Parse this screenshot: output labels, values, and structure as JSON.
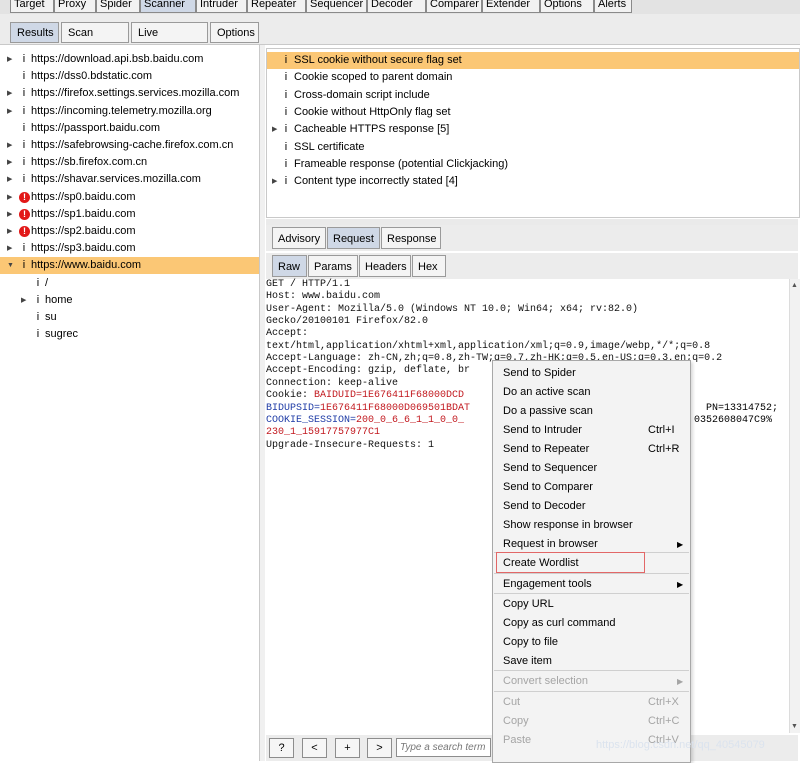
{
  "top_tabs": [
    "Target",
    "Proxy",
    "Spider",
    "Scanner",
    "Intruder",
    "Repeater",
    "Sequencer",
    "Decoder",
    "Comparer",
    "Extender",
    "Options",
    "Alerts"
  ],
  "sub_tabs": [
    "Results",
    "Scan queue",
    "Live scanning",
    "Options"
  ],
  "tree": [
    {
      "label": "https://download.api.bsb.baidu.com",
      "icon": "i",
      "arrow": true
    },
    {
      "label": "https://dss0.bdstatic.com",
      "icon": "i",
      "arrow": false
    },
    {
      "label": "https://firefox.settings.services.mozilla.com",
      "icon": "i",
      "arrow": true
    },
    {
      "label": "https://incoming.telemetry.mozilla.org",
      "icon": "i",
      "arrow": true
    },
    {
      "label": "https://passport.baidu.com",
      "icon": "i",
      "arrow": false
    },
    {
      "label": "https://safebrowsing-cache.firefox.com.cn",
      "icon": "i",
      "arrow": true
    },
    {
      "label": "https://sb.firefox.com.cn",
      "icon": "i",
      "arrow": true
    },
    {
      "label": "https://shavar.services.mozilla.com",
      "icon": "i",
      "arrow": true
    },
    {
      "label": "https://sp0.baidu.com",
      "icon": "!",
      "arrow": true
    },
    {
      "label": "https://sp1.baidu.com",
      "icon": "!",
      "arrow": true
    },
    {
      "label": "https://sp2.baidu.com",
      "icon": "!",
      "arrow": true
    },
    {
      "label": "https://sp3.baidu.com",
      "icon": "i",
      "arrow": true
    },
    {
      "label": "https://www.baidu.com",
      "icon": "i",
      "arrow": true,
      "expanded": true
    },
    {
      "label": "/",
      "icon": "i",
      "arrow": false,
      "indent": 1
    },
    {
      "label": "home",
      "icon": "i",
      "arrow": true,
      "indent": 1
    },
    {
      "label": "su",
      "icon": "i",
      "arrow": false,
      "indent": 1
    },
    {
      "label": "sugrec",
      "icon": "i",
      "arrow": false,
      "indent": 1
    }
  ],
  "issues": [
    {
      "label": "SSL cookie without secure flag set",
      "arrow": false
    },
    {
      "label": "Cookie scoped to parent domain",
      "arrow": false
    },
    {
      "label": "Cross-domain script include",
      "arrow": false
    },
    {
      "label": "Cookie without HttpOnly flag set",
      "arrow": false
    },
    {
      "label": "Cacheable HTTPS response [5]",
      "arrow": true
    },
    {
      "label": "SSL certificate",
      "arrow": false
    },
    {
      "label": "Frameable response (potential Clickjacking)",
      "arrow": false
    },
    {
      "label": "Content type incorrectly stated [4]",
      "arrow": true
    }
  ],
  "detail_tabs": [
    "Advisory",
    "Request",
    "Response"
  ],
  "view_tabs": [
    "Raw",
    "Params",
    "Headers",
    "Hex"
  ],
  "request_lines": [
    {
      "k": "GET / HTTP/1.1"
    },
    {
      "k": "Host: www.baidu.com"
    },
    {
      "k": "User-Agent: Mozilla/5.0 (Windows NT 10.0; Win64; x64; rv:82.0)"
    },
    {
      "k": "Gecko/20100101 Firefox/82.0"
    },
    {
      "k": "Accept:"
    },
    {
      "k": "text/html,application/xhtml+xml,application/xml;q=0.9,image/webp,*/*;q=0.8"
    },
    {
      "k": "Accept-Language: zh-CN,zh;q=0.8,zh-TW;q=0.7,zh-HK;q=0.5,en-US;q=0.3,en;q=0.2"
    },
    {
      "k": "Accept-Encoding: gzip, deflate, br"
    },
    {
      "k": "Connection: keep-alive"
    },
    {
      "k": "Cookie: ",
      "v": "BAIDUID=1E676411F68000DCD"
    },
    {
      "b": "BIDUPSID=",
      "v": "1E676411F68000D069501BDAT",
      "tail": "PN=13314752;"
    },
    {
      "b": "COOKIE_SESSION=",
      "v": "200_0_6_6_1_1_0_0_",
      "tail": "0352608047C9%"
    },
    {
      "v": "230_1_15917757977C1"
    },
    {
      "k": "Upgrade-Insecure-Requests: 1"
    }
  ],
  "bottom_buttons": [
    "?",
    "<",
    "+",
    ">"
  ],
  "search_placeholder": "Type a search term",
  "menu": {
    "items": [
      {
        "label": "Send to Spider",
        "shortcut": "",
        "sub": false,
        "disabled": false
      },
      {
        "label": "Do an active scan",
        "shortcut": "",
        "sub": false,
        "disabled": false
      },
      {
        "label": "Do a passive scan",
        "shortcut": "",
        "sub": false,
        "disabled": false
      },
      {
        "label": "Send to Intruder",
        "shortcut": "Ctrl+I",
        "sub": false,
        "disabled": false
      },
      {
        "label": "Send to Repeater",
        "shortcut": "Ctrl+R",
        "sub": false,
        "disabled": false
      },
      {
        "label": "Send to Sequencer",
        "shortcut": "",
        "sub": false,
        "disabled": false
      },
      {
        "label": "Send to Comparer",
        "shortcut": "",
        "sub": false,
        "disabled": false
      },
      {
        "label": "Send to Decoder",
        "shortcut": "",
        "sub": false,
        "disabled": false
      },
      {
        "label": "Show response in browser",
        "shortcut": "",
        "sub": false,
        "disabled": false
      },
      {
        "label": "Request in browser",
        "shortcut": "",
        "sub": true,
        "disabled": false
      },
      {
        "label": "Create Wordlist",
        "shortcut": "",
        "sub": false,
        "disabled": false,
        "highlight": true
      },
      {
        "label": "Engagement tools",
        "shortcut": "",
        "sub": true,
        "disabled": false
      },
      {
        "label": "Copy URL",
        "shortcut": "",
        "sub": false,
        "disabled": false
      },
      {
        "label": "Copy as curl command",
        "shortcut": "",
        "sub": false,
        "disabled": false
      },
      {
        "label": "Copy to file",
        "shortcut": "",
        "sub": false,
        "disabled": false
      },
      {
        "label": "Save item",
        "shortcut": "",
        "sub": false,
        "disabled": false
      },
      {
        "label": "Convert selection",
        "shortcut": "",
        "sub": true,
        "disabled": true
      },
      {
        "label": "Cut",
        "shortcut": "Ctrl+X",
        "sub": false,
        "disabled": true
      },
      {
        "label": "Copy",
        "shortcut": "Ctrl+C",
        "sub": false,
        "disabled": true
      },
      {
        "label": "Paste",
        "shortcut": "Ctrl+V",
        "sub": false,
        "disabled": true
      }
    ]
  },
  "watermark": "https://blog.csdn.net/qq_40545079",
  "colors": {
    "selection": "#fbc775",
    "error": "#e21818",
    "highlight_box": "#e26767",
    "active_tab": "#cfd8e6"
  }
}
